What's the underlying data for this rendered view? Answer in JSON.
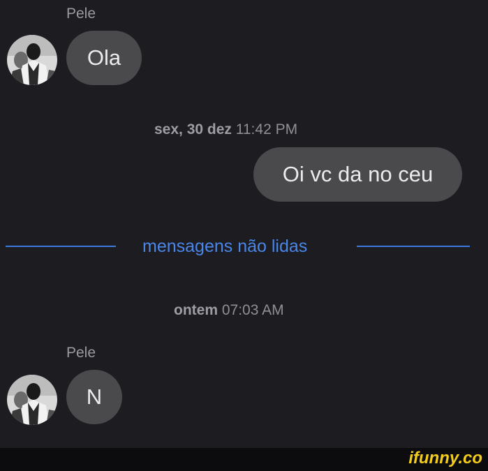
{
  "messages": {
    "first_sender": "Pele",
    "first_text": "Ola",
    "divider1_day": "sex, 30 dez",
    "divider1_time": "11:42 PM",
    "sent_text": "Oi vc da no ceu",
    "unread_label": "mensagens não lidas",
    "divider2_day": "ontem",
    "divider2_time": "07:03 AM",
    "second_sender": "Pele",
    "second_text": "N"
  },
  "watermark": {
    "text": "ifunny.co"
  },
  "colors": {
    "background": "#1c1c21",
    "bubble": "#4a4a4d",
    "accent": "#4a86e8",
    "watermark": "#f4cd1c"
  },
  "icons": {
    "avatar": "profile-photo-icon"
  }
}
